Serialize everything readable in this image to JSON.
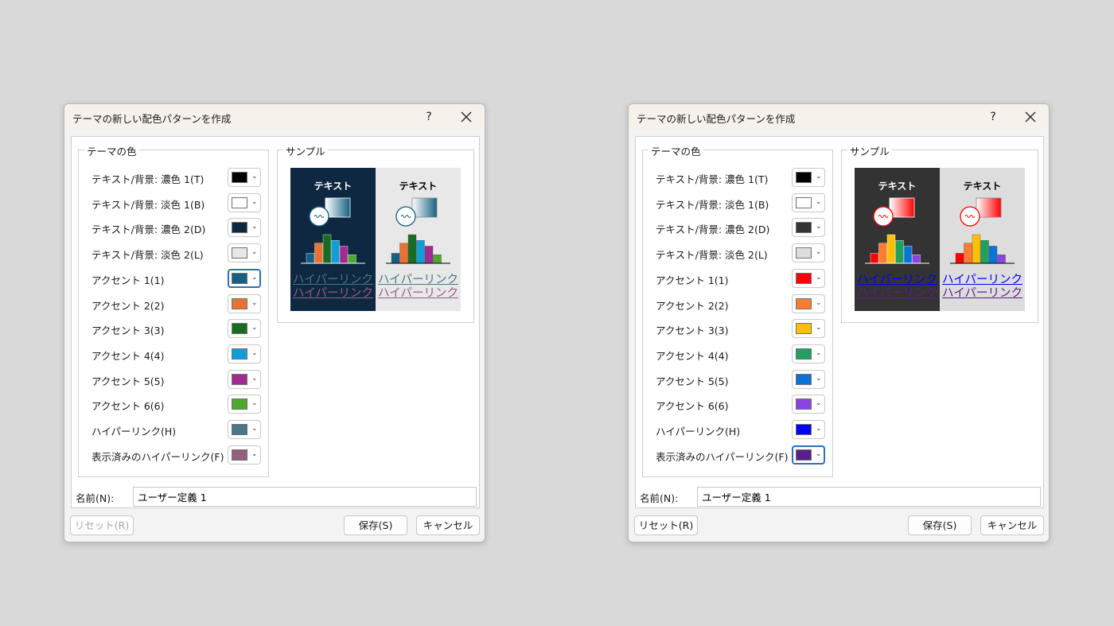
{
  "dialogs": [
    {
      "title": "テーマの新しい配色パターンを作成",
      "help_label": "?",
      "theme_group_label": "テーマの色",
      "sample_group_label": "サンプル",
      "rows": [
        {
          "label": "テキスト/背景: 濃色 1(T)",
          "color": "#000000"
        },
        {
          "label": "テキスト/背景: 淡色 1(B)",
          "color": "#ffffff"
        },
        {
          "label": "テキスト/背景: 濃色 2(D)",
          "color": "#0e2841"
        },
        {
          "label": "テキスト/背景: 淡色 2(L)",
          "color": "#e8e8e8"
        },
        {
          "label": "アクセント 1(1)",
          "color": "#156082"
        },
        {
          "label": "アクセント 2(2)",
          "color": "#e97132"
        },
        {
          "label": "アクセント 3(3)",
          "color": "#196b24"
        },
        {
          "label": "アクセント 4(4)",
          "color": "#0f9ed5"
        },
        {
          "label": "アクセント 5(5)",
          "color": "#a02b93"
        },
        {
          "label": "アクセント 6(6)",
          "color": "#4ea72e"
        },
        {
          "label": "ハイパーリンク(H)",
          "color": "#467886"
        },
        {
          "label": "表示済みのハイパーリンク(F)",
          "color": "#96607d"
        }
      ],
      "focused_row": 4,
      "preview": {
        "text_label": "テキスト",
        "link_label": "ハイパーリンク",
        "visited_label": "ハイパーリンク",
        "dark_bg": "#0e2841",
        "light_bg": "#e8e8e8",
        "dark_text": "#ffffff",
        "light_text": "#000000",
        "shape_fill": "#156082",
        "link_color": "#467886",
        "visited_color": "#96607d",
        "bar_heights": [
          0.35,
          0.7,
          1.0,
          0.8,
          0.6,
          0.3
        ]
      },
      "name_label": "名前(N):",
      "name_value": "ユーザー定義 1",
      "reset_label": "リセット(R)",
      "reset_disabled": true,
      "save_label": "保存(S)",
      "cancel_label": "キャンセル"
    },
    {
      "title": "テーマの新しい配色パターンを作成",
      "help_label": "?",
      "theme_group_label": "テーマの色",
      "sample_group_label": "サンプル",
      "rows": [
        {
          "label": "テキスト/背景: 濃色 1(T)",
          "color": "#000000"
        },
        {
          "label": "テキスト/背景: 淡色 1(B)",
          "color": "#ffffff"
        },
        {
          "label": "テキスト/背景: 濃色 2(D)",
          "color": "#333333"
        },
        {
          "label": "テキスト/背景: 淡色 2(L)",
          "color": "#dddddd"
        },
        {
          "label": "アクセント 1(1)",
          "color": "#ff0000"
        },
        {
          "label": "アクセント 2(2)",
          "color": "#ff7b2e"
        },
        {
          "label": "アクセント 3(3)",
          "color": "#ffc000"
        },
        {
          "label": "アクセント 4(4)",
          "color": "#21a060"
        },
        {
          "label": "アクセント 5(5)",
          "color": "#0b72d6"
        },
        {
          "label": "アクセント 6(6)",
          "color": "#8b44e0"
        },
        {
          "label": "ハイパーリンク(H)",
          "color": "#0000ff"
        },
        {
          "label": "表示済みのハイパーリンク(F)",
          "color": "#5a1e8c"
        }
      ],
      "focused_row": 11,
      "preview": {
        "text_label": "テキスト",
        "link_label": "ハイパーリンク",
        "visited_label": "ハイパーリンク",
        "dark_bg": "#333333",
        "light_bg": "#dddddd",
        "dark_text": "#ffffff",
        "light_text": "#000000",
        "shape_fill": "#ff0000",
        "link_color": "#0000ff",
        "visited_color": "#5a1e8c",
        "bar_heights": [
          0.35,
          0.7,
          1.0,
          0.8,
          0.6,
          0.3
        ]
      },
      "name_label": "名前(N):",
      "name_value": "ユーザー定義 1",
      "reset_label": "リセット(R)",
      "reset_disabled": false,
      "save_label": "保存(S)",
      "cancel_label": "キャンセル"
    }
  ]
}
